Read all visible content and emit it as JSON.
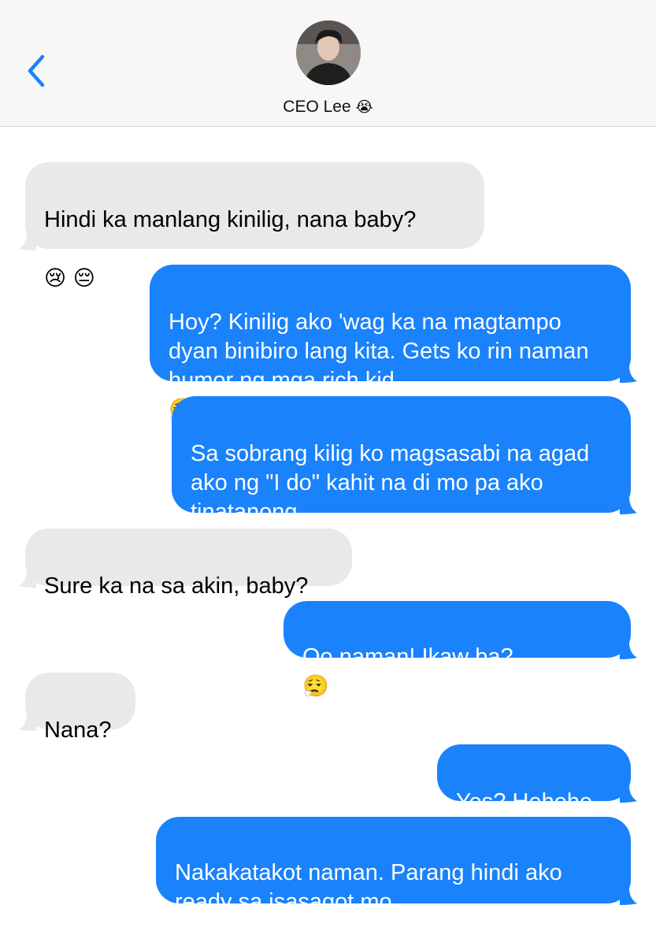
{
  "header": {
    "contact_name": "CEO Lee",
    "contact_emoji": "😭"
  },
  "messages": [
    {
      "direction": "incoming",
      "text": "Hindi ka manlang kinilig, nana baby?",
      "emoji": "😢 😔"
    },
    {
      "direction": "outgoing",
      "text": "Hoy? Kinilig ako 'wag ka na magtampo dyan binibiro lang kita. Gets ko rin naman humor ng mga rich kid.",
      "emoji": "😮‍💨 😅"
    },
    {
      "direction": "outgoing",
      "text": "Sa sobrang kilig ko magsasabi na agad ako ng \"I do\" kahit na di mo pa ako tinatanong",
      "emoji": ""
    },
    {
      "direction": "incoming",
      "text": "Sure ka na sa akin, baby?",
      "emoji": ""
    },
    {
      "direction": "outgoing",
      "text": "Oo naman! Ikaw ba?",
      "emoji": "😮‍💨 😀"
    },
    {
      "direction": "incoming",
      "text": "Nana?",
      "emoji": ""
    },
    {
      "direction": "outgoing",
      "text": "Yes? Hehehe.",
      "emoji": ""
    },
    {
      "direction": "outgoing",
      "text": "Nakakatakot naman. Parang hindi ako ready sa isasagot mo.",
      "emoji": "😅"
    }
  ],
  "colors": {
    "outgoing_bubble": "#1a82fb",
    "incoming_bubble": "#e9e9eb",
    "back_chevron": "#1a82fb",
    "header_bg": "#f7f7f7"
  },
  "icons": {
    "back": "chevron-left-icon",
    "avatar": "contact-avatar"
  }
}
